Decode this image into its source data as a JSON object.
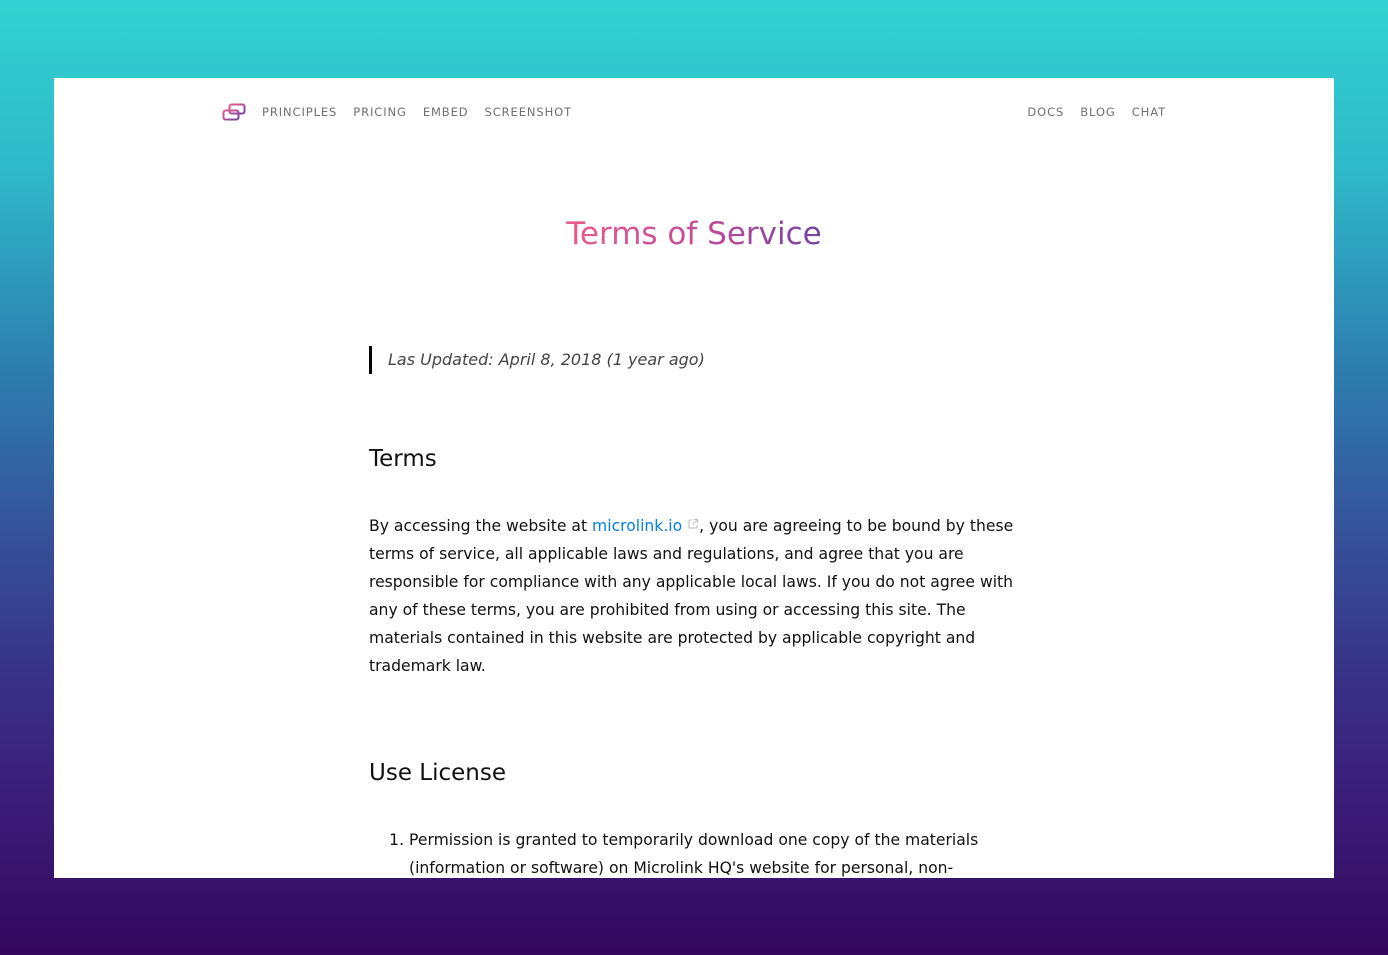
{
  "nav": {
    "left": [
      "PRINCIPLES",
      "PRICING",
      "EMBED",
      "SCREENSHOT"
    ],
    "right": [
      "DOCS",
      "BLOG",
      "CHAT"
    ],
    "logo_icon": "microlink-logo-icon"
  },
  "page": {
    "title": "Terms of Service",
    "last_updated": "Las Updated: April 8, 2018 (1 year ago)"
  },
  "terms": {
    "heading": "Terms",
    "text_before_link": "By accessing the website at ",
    "link_text": "microlink.io",
    "link_icon": "external-link-icon",
    "text_after_link": ", you are agreeing to be bound by these terms of service, all applicable laws and regulations, and agree that you are responsible for compliance with any applicable local laws. If you do not agree with any of these terms, you are prohibited from using or accessing this site. The materials contained in this website are protected by applicable copyright and trademark law."
  },
  "license": {
    "heading": "Use License",
    "items": [
      "Permission is granted to temporarily download one copy of the materials (information or software) on Microlink HQ's website for personal, non-commercial transitory viewing only. This is the grant of a license, not a transfer"
    ]
  },
  "colors": {
    "title_gradient_start": "#ec5b8b",
    "title_gradient_end": "#7443a3",
    "link": "#0a7ee8",
    "background_top": "#31d3d1",
    "background_bottom": "#33085e"
  }
}
